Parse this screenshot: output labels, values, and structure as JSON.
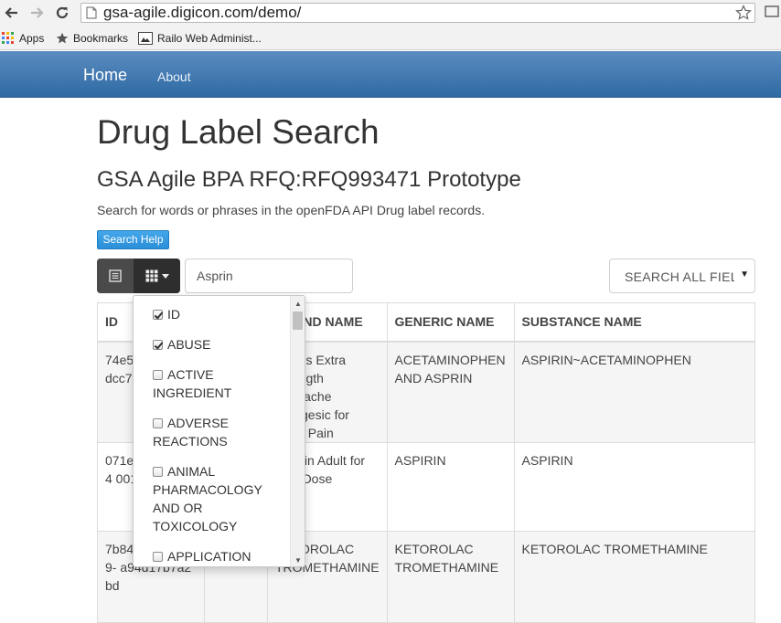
{
  "browser": {
    "url": "gsa-agile.digicon.com/demo/",
    "bookmarks": [
      "Apps",
      "Bookmarks",
      "Railo Web Administ..."
    ]
  },
  "navbar": {
    "brand": "Home",
    "about": "About"
  },
  "page": {
    "title": "Drug Label Search",
    "subtitle": "GSA Agile BPA RFQ:RFQ993471 Prototype",
    "lead": "Search for words or phrases in the openFDA API Drug label records.",
    "help_button": "Search Help"
  },
  "search": {
    "value": "Asprin",
    "field_select": "SEARCH ALL FIELDS"
  },
  "table": {
    "headers": [
      "ID",
      "",
      "BRAND NAME",
      "GENERIC NAME",
      "SUBSTANCE NAME"
    ],
    "rows": [
      {
        "id": "74e5 b052 a7ff- dcc7",
        "set": "",
        "brand": "Doans Extra Strength Backache Analgesic for Body Pain",
        "generic": "ACETAMINOPHEN AND ASPRIN",
        "substance": "ASPIRIN~ACETAMINOPHEN"
      },
      {
        "id": "071e 4642 e054 0014",
        "set": "",
        "brand": "Aspirin Adult for Low Dose",
        "generic": "ASPIRIN",
        "substance": "ASPIRIN"
      },
      {
        "id": "7b84 03b9 a9b9- a94d17b7a2bd",
        "set": "",
        "brand": "KETOROLAC TROMETHAMINE",
        "generic": "KETOROLAC TROMETHAMINE",
        "substance": "KETOROLAC TROMETHAMINE"
      }
    ]
  },
  "columns_dropdown": {
    "items": [
      {
        "label": "ID",
        "checked": true
      },
      {
        "label": "ABUSE",
        "checked": true
      },
      {
        "label": "ACTIVE INGREDIENT",
        "checked": false
      },
      {
        "label": "ADVERSE REACTIONS",
        "checked": false
      },
      {
        "label": "ANIMAL PHARMACOLOGY AND OR TOXICOLOGY",
        "checked": false
      },
      {
        "label": "APPLICATION",
        "checked": false
      }
    ]
  },
  "colors": {
    "navbar": "#2f6aa3",
    "help_button": "#2a8fd8",
    "toggle": "#3f3f3f"
  }
}
